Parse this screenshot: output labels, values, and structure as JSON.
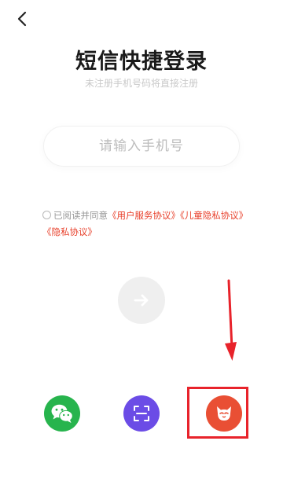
{
  "header": {
    "back_icon": "chevron-left-icon",
    "title": "短信快捷登录",
    "subtitle": "未注册手机号码将直接注册"
  },
  "phone": {
    "placeholder": "请输入手机号",
    "value": ""
  },
  "agreement": {
    "checked": false,
    "prefix": "已阅读并同意",
    "user_service": "《用户服务协议》",
    "child_privacy": "《儿童隐私协议》",
    "privacy": "《隐私协议》",
    "link_color": "#e8412c"
  },
  "next_button": {
    "icon": "arrow-right-icon",
    "enabled": false
  },
  "social_login": [
    {
      "name": "wechat",
      "icon": "wechat-icon",
      "color": "#27b44d"
    },
    {
      "name": "scan",
      "icon": "scan-icon",
      "color": "#6b4ce6"
    },
    {
      "name": "brand",
      "icon": "fox-logo-icon",
      "color": "#e94f34"
    }
  ],
  "annotation": {
    "color": "#e8232b",
    "target": "brand"
  }
}
